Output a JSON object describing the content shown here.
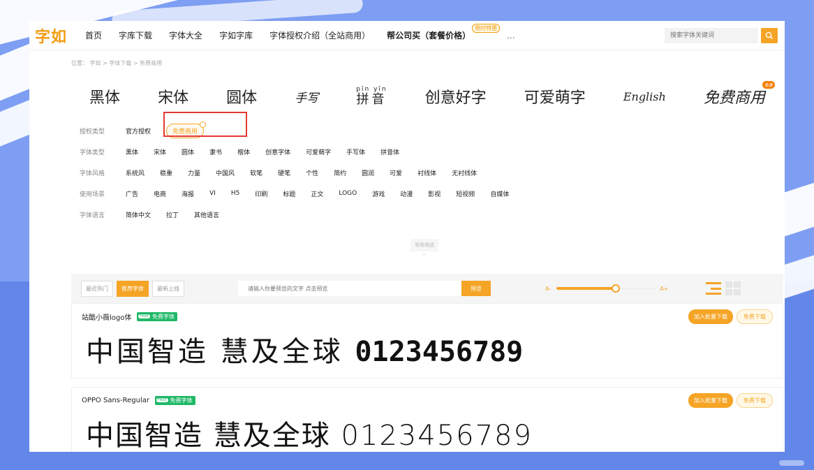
{
  "brand": {
    "logo": "字如"
  },
  "nav": {
    "items": [
      "首页",
      "字库下载",
      "字体大全",
      "字如字库",
      "字体授权介绍（全站商用）"
    ],
    "promo": "帮公司买（套餐价格）",
    "promo_badge": "限时特惠",
    "more": "..."
  },
  "search": {
    "placeholder": "搜索字体关键词"
  },
  "breadcrumb": "位置：  字如 > 字体下载 > 免费商用",
  "font_categories": [
    "黑体",
    "宋体",
    "圆体",
    "手写",
    "拼音",
    "创意好字",
    "可爱萌字",
    "English",
    "免费商用"
  ],
  "pinyin_category": {
    "pinyin": "pīn yīn",
    "hanzi": "拼音"
  },
  "free_corner_badge": "免费",
  "filters": [
    {
      "label": "授权类型",
      "options": [
        "官方授权",
        "免费商用"
      ],
      "active": 1
    },
    {
      "label": "字体类型",
      "options": [
        "黑体",
        "宋体",
        "圆体",
        "隶书",
        "楷体",
        "创意字体",
        "可爱萌字",
        "手写体",
        "拼音体"
      ]
    },
    {
      "label": "字体风格",
      "options": [
        "系统风",
        "稳重",
        "力量",
        "中国风",
        "软笔",
        "硬笔",
        "个性",
        "简约",
        "圆润",
        "可爱",
        "衬线体",
        "无衬线体"
      ]
    },
    {
      "label": "使用场景",
      "options": [
        "广告",
        "电商",
        "海报",
        "VI",
        "H5",
        "印刷",
        "标题",
        "正文",
        "LOGO",
        "游戏",
        "动漫",
        "影视",
        "短视频",
        "自媒体"
      ]
    },
    {
      "label": "字体语言",
      "options": [
        "简体中文",
        "拉丁",
        "其他语言"
      ]
    }
  ],
  "common_filter": {
    "label": "常用筛选",
    "caret": "^"
  },
  "toolbar": {
    "tabs": [
      "最近热门",
      "推荐字体",
      "最新上线"
    ],
    "active_tab": 1,
    "preview_placeholder": "请输入你要预览的文字 点击预览",
    "preview_button": "预览",
    "size_minus": "A-",
    "size_plus": "A+",
    "size_level": 0.62
  },
  "fonts": [
    {
      "name": "站酷小薇logo体",
      "free_badge": "FREE",
      "tag": "免费字体",
      "preview_text": "中国智造 慧及全球",
      "preview_digits": "0123456789"
    },
    {
      "name": "OPPO Sans-Regular",
      "free_badge": "FREE",
      "tag": "免费字体",
      "preview_text": "中国智造 慧及全球",
      "preview_digits": "0123456789"
    }
  ],
  "card_actions": {
    "batch": "加入批量下载",
    "download": "免费下载"
  },
  "colors": {
    "accent": "#f5a425",
    "free_green": "#1fb867",
    "highlight_red": "#e53935",
    "background": "#7d9ef2"
  }
}
